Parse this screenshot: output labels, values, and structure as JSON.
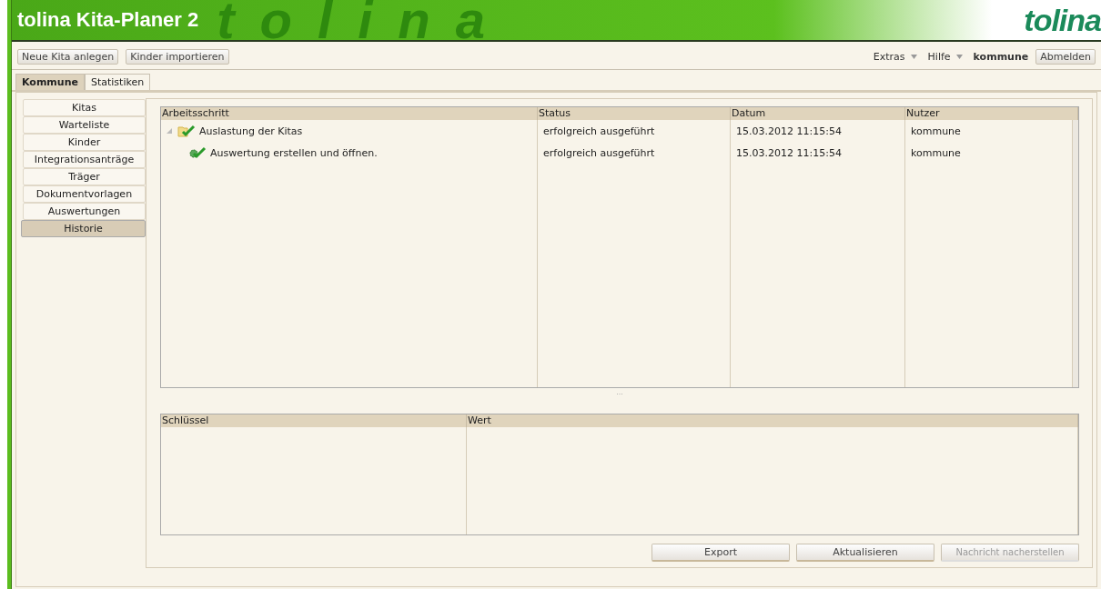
{
  "window": {
    "title": "tolina Kita-Planer 2",
    "logo": "tolina",
    "background_lettering": "tolina"
  },
  "toolbar": {
    "buttons": [
      "Neue Kita anlegen",
      "Kinder importieren"
    ],
    "menus": [
      "Extras",
      "Hilfe"
    ],
    "user": "kommune",
    "logout": "Abmelden"
  },
  "tabs": [
    {
      "label": "Kommune",
      "selected": true
    },
    {
      "label": "Statistiken",
      "selected": false
    }
  ],
  "sidebar": {
    "items": [
      {
        "label": "Kitas",
        "selected": false
      },
      {
        "label": "Warteliste",
        "selected": false
      },
      {
        "label": "Kinder",
        "selected": false
      },
      {
        "label": "Integrationsanträge",
        "selected": false
      },
      {
        "label": "Träger",
        "selected": false
      },
      {
        "label": "Dokumentvorlagen",
        "selected": false
      },
      {
        "label": "Auswertungen",
        "selected": false
      },
      {
        "label": "Historie",
        "selected": true
      }
    ]
  },
  "history_table": {
    "columns": [
      "Arbeitsschritt",
      "Status",
      "Datum",
      "Nutzer"
    ],
    "rows": [
      {
        "kind": "folder",
        "expanded": true,
        "step": "Auslastung der Kitas",
        "status": "erfolgreich ausgeführt",
        "date": "15.03.2012 11:15:54",
        "user": "kommune",
        "children": [
          {
            "kind": "task",
            "step": "Auswertung erstellen und öffnen.",
            "status": "erfolgreich ausgeführt",
            "date": "15.03.2012 11:15:54",
            "user": "kommune"
          }
        ]
      }
    ]
  },
  "splitter": "...",
  "details_table": {
    "columns": [
      "Schlüssel",
      "Wert"
    ]
  },
  "buttons": [
    {
      "label": "Export",
      "disabled": false
    },
    {
      "label": "Aktualisieren",
      "disabled": false
    },
    {
      "label": "Nachricht nacherstellen",
      "disabled": true
    }
  ]
}
